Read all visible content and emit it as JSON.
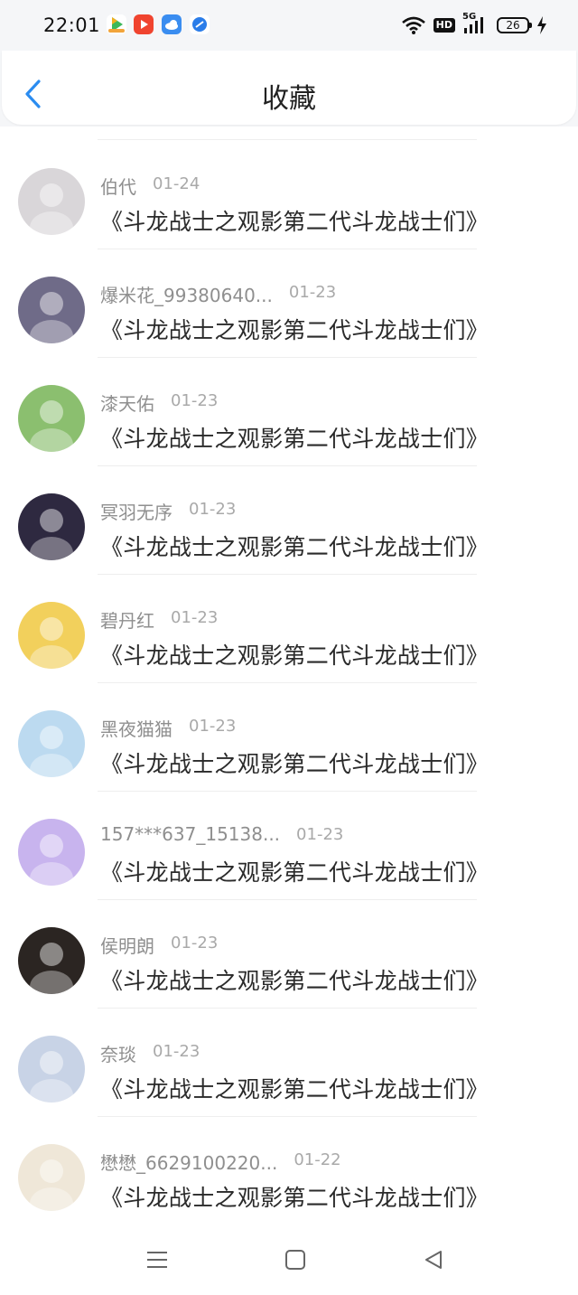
{
  "status_bar": {
    "time": "22:01",
    "network": "HD",
    "signal": "5G",
    "battery": "26"
  },
  "header": {
    "back_icon": "chevron-left-icon",
    "title": "收藏",
    "accent": "#2b8cf0"
  },
  "items": [
    {
      "user": "伯代",
      "time": "01-24",
      "title": "《斗龙战士之观影第二代斗龙战士们》",
      "avatar_color": "#d9d6d9"
    },
    {
      "user": "爆米花_99380640...",
      "time": "01-23",
      "title": "《斗龙战士之观影第二代斗龙战士们》",
      "avatar_color": "#6f6b88"
    },
    {
      "user": "漆天佑",
      "time": "01-23",
      "title": "《斗龙战士之观影第二代斗龙战士们》",
      "avatar_color": "#8bbf6f"
    },
    {
      "user": "冥羽无序",
      "time": "01-23",
      "title": "《斗龙战士之观影第二代斗龙战士们》",
      "avatar_color": "#2e2940"
    },
    {
      "user": "碧丹红",
      "time": "01-23",
      "title": "《斗龙战士之观影第二代斗龙战士们》",
      "avatar_color": "#f2d05c"
    },
    {
      "user": "黑夜猫猫",
      "time": "01-23",
      "title": "《斗龙战士之观影第二代斗龙战士们》",
      "avatar_color": "#bcdaf0"
    },
    {
      "user": "157***637_15138...",
      "time": "01-23",
      "title": "《斗龙战士之观影第二代斗龙战士们》",
      "avatar_color": "#c8b4ee"
    },
    {
      "user": "侯明朗",
      "time": "01-23",
      "title": "《斗龙战士之观影第二代斗龙战士们》",
      "avatar_color": "#2b2522"
    },
    {
      "user": "奈琰",
      "time": "01-23",
      "title": "《斗龙战士之观影第二代斗龙战士们》",
      "avatar_color": "#c8d3e6"
    },
    {
      "user": "懋懋_6629100220...",
      "time": "01-22",
      "title": "《斗龙战士之观影第二代斗龙战士们》",
      "avatar_color": "#efe7d8"
    }
  ],
  "nav": {
    "menu_icon": "menu-icon",
    "home_icon": "home-icon",
    "back_icon": "back-triangle-icon"
  }
}
